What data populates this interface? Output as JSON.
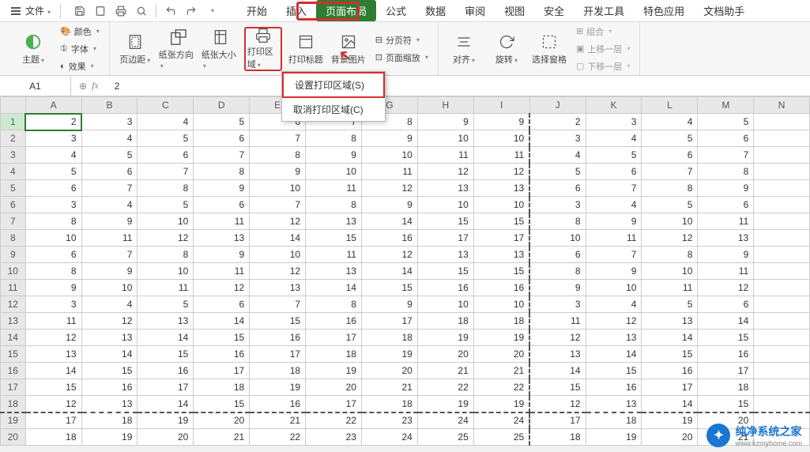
{
  "menubar": {
    "file": "文件",
    "tabs": [
      "开始",
      "插入",
      "页面布局",
      "公式",
      "数据",
      "审阅",
      "视图",
      "安全",
      "开发工具",
      "特色应用",
      "文档助手"
    ],
    "active_tab_index": 2
  },
  "ribbon": {
    "theme": "主题",
    "colors": "颜色",
    "fonts": "字体",
    "effects": "效果",
    "margins": "页边距",
    "orientation": "纸张方向",
    "size": "纸张大小",
    "print_area": "打印区域",
    "print_titles": "打印标题",
    "background": "背景图片",
    "breaks": "分页符",
    "scale": "页面缩放",
    "align": "对齐",
    "rotate": "旋转",
    "select_pane": "选择窗格",
    "group": "组合",
    "forward": "上移一层",
    "backward": "下移一层"
  },
  "dropdown": {
    "set_area": "设置打印区域(S)",
    "cancel_area": "取消打印区域(C)"
  },
  "formula_bar": {
    "name": "A1",
    "value": "2"
  },
  "grid": {
    "columns": [
      "A",
      "B",
      "C",
      "D",
      "E",
      "F",
      "G",
      "H",
      "I",
      "J",
      "K",
      "L",
      "M",
      "N"
    ],
    "rows": [
      [
        2,
        3,
        4,
        5,
        6,
        7,
        8,
        9,
        9,
        2,
        3,
        4,
        5,
        ""
      ],
      [
        3,
        4,
        5,
        6,
        7,
        8,
        9,
        10,
        10,
        3,
        4,
        5,
        6,
        ""
      ],
      [
        4,
        5,
        6,
        7,
        8,
        9,
        10,
        11,
        11,
        4,
        5,
        6,
        7,
        ""
      ],
      [
        5,
        6,
        7,
        8,
        9,
        10,
        11,
        12,
        12,
        5,
        6,
        7,
        8,
        ""
      ],
      [
        6,
        7,
        8,
        9,
        10,
        11,
        12,
        13,
        13,
        6,
        7,
        8,
        9,
        ""
      ],
      [
        3,
        4,
        5,
        6,
        7,
        8,
        9,
        10,
        10,
        3,
        4,
        5,
        6,
        ""
      ],
      [
        8,
        9,
        10,
        11,
        12,
        13,
        14,
        15,
        15,
        8,
        9,
        10,
        11,
        ""
      ],
      [
        10,
        11,
        12,
        13,
        14,
        15,
        16,
        17,
        17,
        10,
        11,
        12,
        13,
        ""
      ],
      [
        6,
        7,
        8,
        9,
        10,
        11,
        12,
        13,
        13,
        6,
        7,
        8,
        9,
        ""
      ],
      [
        8,
        9,
        10,
        11,
        12,
        13,
        14,
        15,
        15,
        8,
        9,
        10,
        11,
        ""
      ],
      [
        9,
        10,
        11,
        12,
        13,
        14,
        15,
        16,
        16,
        9,
        10,
        11,
        12,
        ""
      ],
      [
        3,
        4,
        5,
        6,
        7,
        8,
        9,
        10,
        10,
        3,
        4,
        5,
        6,
        ""
      ],
      [
        11,
        12,
        13,
        14,
        15,
        16,
        17,
        18,
        18,
        11,
        12,
        13,
        14,
        ""
      ],
      [
        12,
        13,
        14,
        15,
        16,
        17,
        18,
        19,
        19,
        12,
        13,
        14,
        15,
        ""
      ],
      [
        13,
        14,
        15,
        16,
        17,
        18,
        19,
        20,
        20,
        13,
        14,
        15,
        16,
        ""
      ],
      [
        14,
        15,
        16,
        17,
        18,
        19,
        20,
        21,
        21,
        14,
        15,
        16,
        17,
        ""
      ],
      [
        15,
        16,
        17,
        18,
        19,
        20,
        21,
        22,
        22,
        15,
        16,
        17,
        18,
        ""
      ],
      [
        12,
        13,
        14,
        15,
        16,
        17,
        18,
        19,
        19,
        12,
        13,
        14,
        15,
        ""
      ],
      [
        17,
        18,
        19,
        20,
        21,
        22,
        23,
        24,
        24,
        17,
        18,
        19,
        20,
        ""
      ],
      [
        18,
        19,
        20,
        21,
        22,
        23,
        24,
        25,
        25,
        18,
        19,
        20,
        21,
        ""
      ]
    ]
  },
  "watermark": {
    "title": "纯净系统之家",
    "sub": "www.kzmyhome.com"
  }
}
